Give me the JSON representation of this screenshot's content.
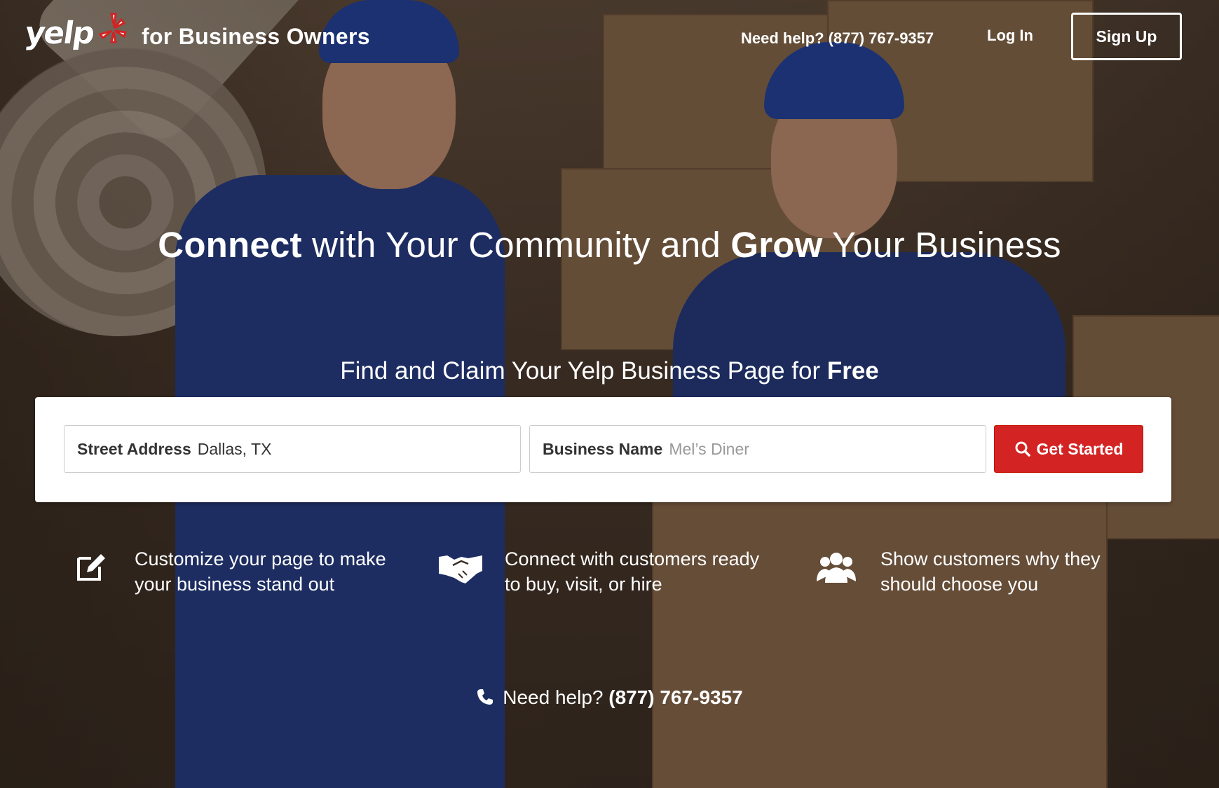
{
  "header": {
    "logo_text": "yelp",
    "tagline": "for Business Owners",
    "help_text": "Need help? (877) 767-9357",
    "login_label": "Log In",
    "signup_label": "Sign Up"
  },
  "hero": {
    "headline": {
      "part1_bold": "Connect",
      "part2": " with Your Community and ",
      "part3_bold": "Grow",
      "part4": " Your Business"
    },
    "subhead": {
      "text": "Find and Claim Your Yelp Business Page for ",
      "bold": "Free"
    }
  },
  "search": {
    "address_label": "Street Address",
    "address_value": "Dallas, TX",
    "business_label": "Business Name",
    "business_placeholder": "Mel’s Diner",
    "cta_label": "Get Started"
  },
  "features": [
    {
      "icon": "edit-icon",
      "text": "Customize your page to make your business stand out"
    },
    {
      "icon": "handshake-icon",
      "text": "Connect with customers ready to buy, visit, or hire"
    },
    {
      "icon": "people-icon",
      "text": "Show customers why they should choose you"
    }
  ],
  "footer_help": {
    "text": "Need help? ",
    "phone": "(877) 767-9357"
  },
  "colors": {
    "brand_red": "#d32323",
    "text_white": "#ffffff"
  }
}
